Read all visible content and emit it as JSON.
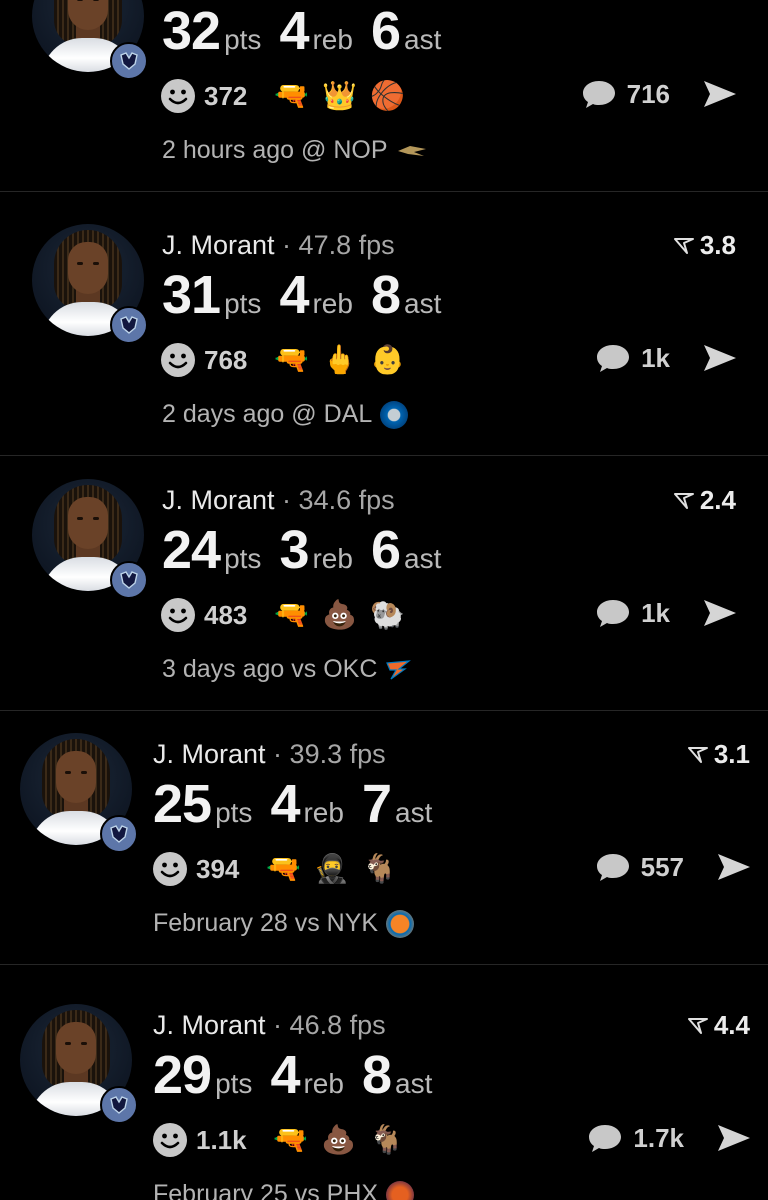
{
  "posts": [
    {
      "player": "",
      "fps": "",
      "rating": "",
      "pts": "32",
      "reb": "4",
      "ast": "6",
      "pts_label": "pts",
      "reb_label": "reb",
      "ast_label": "ast",
      "reactions": "372",
      "reaction_emojis": [
        "🔫",
        "👑",
        "🏀"
      ],
      "comments": "716",
      "time_context": "2 hours ago @ NOP",
      "opp_color": "#b4975a"
    },
    {
      "player": "J. Morant",
      "fps": "47.8 fps",
      "rating": "3.8",
      "pts": "31",
      "reb": "4",
      "ast": "8",
      "pts_label": "pts",
      "reb_label": "reb",
      "ast_label": "ast",
      "reactions": "768",
      "reaction_emojis": [
        "🔫",
        "🖕",
        "👶"
      ],
      "comments": "1k",
      "time_context": "2 days ago @ DAL",
      "opp_color": "#0064b1"
    },
    {
      "player": "J. Morant",
      "fps": "34.6 fps",
      "rating": "2.4",
      "pts": "24",
      "reb": "3",
      "ast": "6",
      "pts_label": "pts",
      "reb_label": "reb",
      "ast_label": "ast",
      "reactions": "483",
      "reaction_emojis": [
        "🔫",
        "💩",
        "🐏"
      ],
      "comments": "1k",
      "time_context": "3 days ago vs OKC",
      "opp_color": "#ef6a2a"
    },
    {
      "player": "J. Morant",
      "fps": "39.3 fps",
      "rating": "3.1",
      "pts": "25",
      "reb": "4",
      "ast": "7",
      "pts_label": "pts",
      "reb_label": "reb",
      "ast_label": "ast",
      "reactions": "394",
      "reaction_emojis": [
        "🔫",
        "🥷",
        "🐐"
      ],
      "comments": "557",
      "time_context": "February 28 vs NYK",
      "opp_color": "#f58426"
    },
    {
      "player": "J. Morant",
      "fps": "46.8 fps",
      "rating": "4.4",
      "pts": "29",
      "reb": "4",
      "ast": "8",
      "pts_label": "pts",
      "reb_label": "reb",
      "ast_label": "ast",
      "reactions": "1.1k",
      "reaction_emojis": [
        "🔫",
        "💩",
        "🐐"
      ],
      "comments": "1.7k",
      "time_context": "February 25 vs PHX",
      "opp_color": "#e56020"
    }
  ],
  "colors": {
    "background": "#000000",
    "divider": "#262626",
    "badge": "#5d76a9"
  }
}
